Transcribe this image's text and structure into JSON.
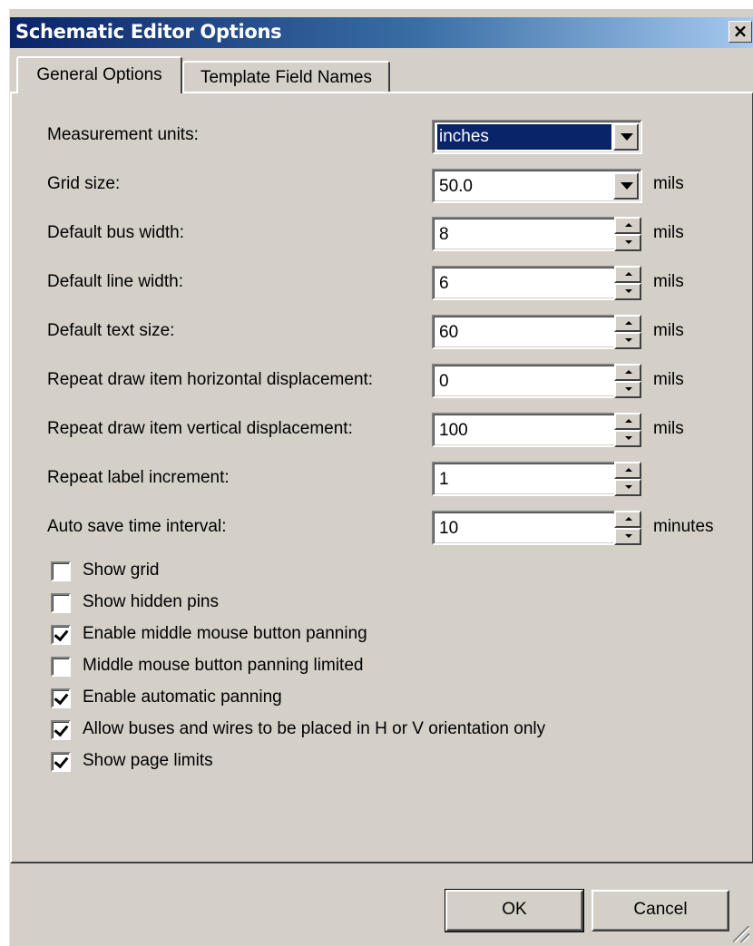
{
  "window": {
    "title": "Schematic Editor Options",
    "close_glyph": "×"
  },
  "tabs": [
    {
      "label": "General Options",
      "active": true
    },
    {
      "label": "Template Field Names",
      "active": false
    }
  ],
  "fields": {
    "measurement_units": {
      "label": "Measurement units:",
      "value": "inches",
      "selected": true
    },
    "grid_size": {
      "label": "Grid size:",
      "value": "50.0",
      "unit": "mils"
    },
    "bus_width": {
      "label": "Default bus width:",
      "value": "8",
      "unit": "mils"
    },
    "line_width": {
      "label": "Default line width:",
      "value": "6",
      "unit": "mils"
    },
    "text_size": {
      "label": "Default text size:",
      "value": "60",
      "unit": "mils"
    },
    "repeat_h": {
      "label": "Repeat draw item horizontal displacement:",
      "value": "0",
      "unit": "mils"
    },
    "repeat_v": {
      "label": "Repeat draw item vertical displacement:",
      "value": "100",
      "unit": "mils"
    },
    "repeat_label": {
      "label": "Repeat label increment:",
      "value": "1"
    },
    "autosave": {
      "label": "Auto save time interval:",
      "value": "10",
      "unit": "minutes"
    }
  },
  "checkboxes": [
    {
      "label": "Show grid",
      "checked": false
    },
    {
      "label": "Show hidden pins",
      "checked": false
    },
    {
      "label": "Enable middle mouse button panning",
      "checked": true
    },
    {
      "label": "Middle mouse button panning limited",
      "checked": false
    },
    {
      "label": "Enable automatic panning",
      "checked": true
    },
    {
      "label": "Allow buses and wires to be placed in H or V orientation only",
      "checked": true
    },
    {
      "label": "Show page limits",
      "checked": true
    }
  ],
  "buttons": {
    "ok": "OK",
    "cancel": "Cancel"
  },
  "colors": {
    "dialog_bg": "#d4d0c8",
    "title_gradient_start": "#0a246a",
    "title_gradient_end": "#a6caf0",
    "selection": "#0a246a"
  }
}
